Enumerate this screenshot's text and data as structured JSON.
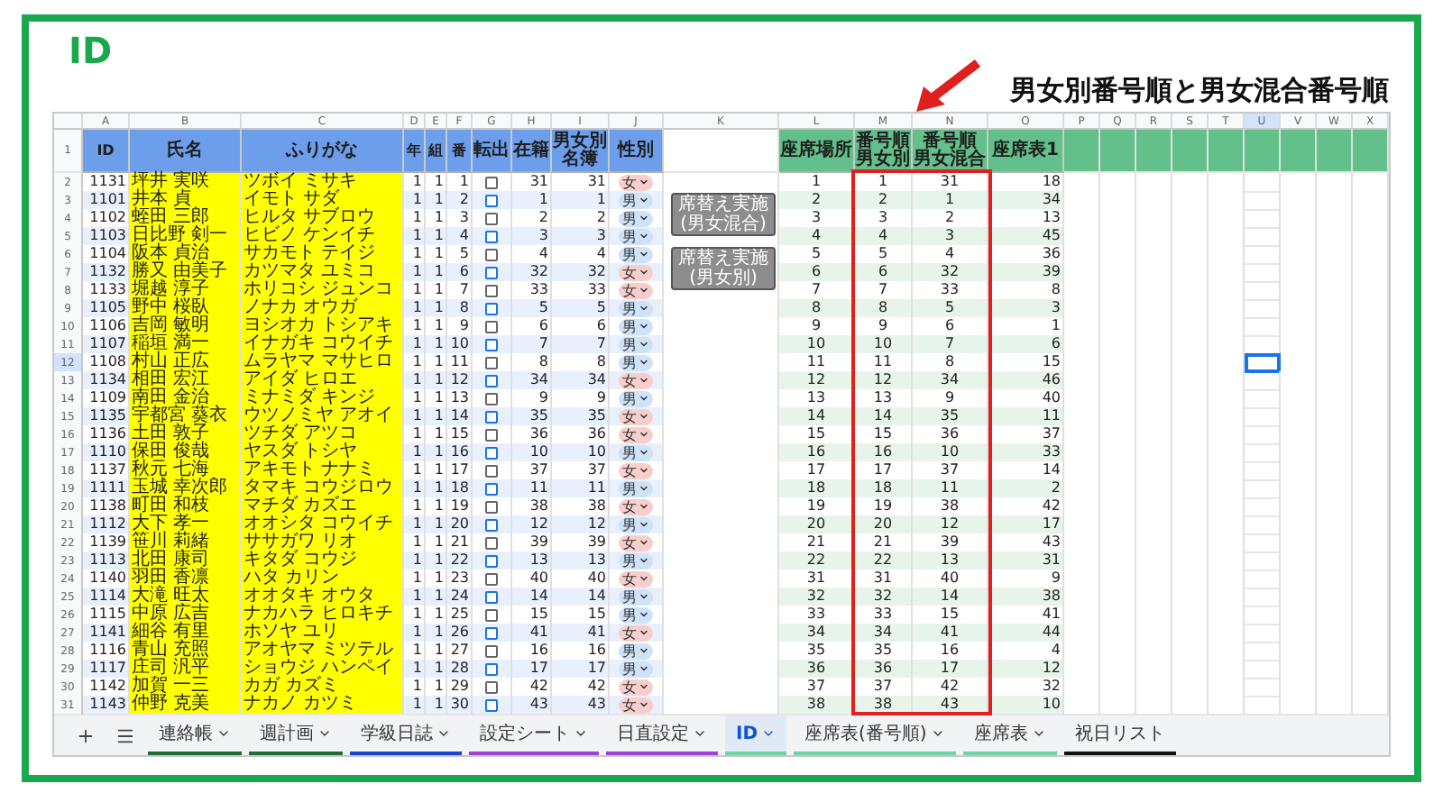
{
  "slide": {
    "title": "ID"
  },
  "annotation": {
    "text": "男女別番号順と男女混合番号順"
  },
  "sheet": {
    "column_letters": [
      {
        "label": "A",
        "selected": false
      },
      {
        "label": "B",
        "selected": false
      },
      {
        "label": "C",
        "selected": false
      },
      {
        "label": "D",
        "selected": false
      },
      {
        "label": "E",
        "selected": false
      },
      {
        "label": "F",
        "selected": false
      },
      {
        "label": "G",
        "selected": false
      },
      {
        "label": "H",
        "selected": false
      },
      {
        "label": "I",
        "selected": false
      },
      {
        "label": "J",
        "selected": false
      },
      {
        "label": "K",
        "selected": false
      },
      {
        "label": "L",
        "selected": false
      },
      {
        "label": "M",
        "selected": false
      },
      {
        "label": "N",
        "selected": false
      },
      {
        "label": "O",
        "selected": false
      },
      {
        "label": "P",
        "selected": false
      },
      {
        "label": "Q",
        "selected": false
      },
      {
        "label": "R",
        "selected": false
      },
      {
        "label": "S",
        "selected": false
      },
      {
        "label": "T",
        "selected": false
      },
      {
        "label": "U",
        "selected": true
      },
      {
        "label": "V",
        "selected": false
      },
      {
        "label": "W",
        "selected": false
      },
      {
        "label": "X",
        "selected": false
      }
    ],
    "header_row": "1",
    "left_headers": [
      "ID",
      "氏名",
      "ふりがな",
      "年",
      "組",
      "番",
      "転出",
      "在籍",
      "男女別名簿",
      "性別"
    ],
    "right_headers": [
      [
        "座席場所"
      ],
      [
        "番号順",
        "男女別"
      ],
      [
        "番号順",
        "男女混合"
      ],
      [
        "座席表1"
      ]
    ],
    "buttons": [
      "席替え実施\n(男女混合)",
      "席替え実施\n(男女別)"
    ],
    "rows": [
      {
        "row": "2",
        "id": "1131",
        "name": "坪井 実咲",
        "kana": "ツボイ ミサキ",
        "year": "1",
        "class": "1",
        "number": "1",
        "transferred": false,
        "enrolled": "31",
        "gender_roster": "31",
        "sex": {
          "value": "女",
          "color": "#f6cfcc"
        },
        "seat_place": "1",
        "order_by_gender": "1",
        "mixed_order": "31",
        "seating_1": "18",
        "selected": false
      },
      {
        "row": "3",
        "id": "1101",
        "name": "井本 貞",
        "kana": "イモト サダ",
        "year": "1",
        "class": "1",
        "number": "2",
        "transferred": false,
        "enrolled": "1",
        "gender_roster": "1",
        "sex": {
          "value": "男",
          "color": "#cfe2f8"
        },
        "seat_place": "2",
        "order_by_gender": "2",
        "mixed_order": "1",
        "seating_1": "34",
        "selected": false
      },
      {
        "row": "4",
        "id": "1102",
        "name": "蛭田 三郎",
        "kana": "ヒルタ サブロウ",
        "year": "1",
        "class": "1",
        "number": "3",
        "transferred": false,
        "enrolled": "2",
        "gender_roster": "2",
        "sex": {
          "value": "男",
          "color": "#cfe2f8"
        },
        "seat_place": "3",
        "order_by_gender": "3",
        "mixed_order": "2",
        "seating_1": "13",
        "selected": false
      },
      {
        "row": "5",
        "id": "1103",
        "name": "日比野 剣一",
        "kana": "ヒビノ ケンイチ",
        "year": "1",
        "class": "1",
        "number": "4",
        "transferred": false,
        "enrolled": "3",
        "gender_roster": "3",
        "sex": {
          "value": "男",
          "color": "#cfe2f8"
        },
        "seat_place": "4",
        "order_by_gender": "4",
        "mixed_order": "3",
        "seating_1": "45",
        "selected": false
      },
      {
        "row": "6",
        "id": "1104",
        "name": "阪本 貞治",
        "kana": "サカモト テイジ",
        "year": "1",
        "class": "1",
        "number": "5",
        "transferred": false,
        "enrolled": "4",
        "gender_roster": "4",
        "sex": {
          "value": "男",
          "color": "#cfe2f8"
        },
        "seat_place": "5",
        "order_by_gender": "5",
        "mixed_order": "4",
        "seating_1": "36",
        "selected": false
      },
      {
        "row": "7",
        "id": "1132",
        "name": "勝又 由美子",
        "kana": "カツマタ ユミコ",
        "year": "1",
        "class": "1",
        "number": "6",
        "transferred": false,
        "enrolled": "32",
        "gender_roster": "32",
        "sex": {
          "value": "女",
          "color": "#f6cfcc"
        },
        "seat_place": "6",
        "order_by_gender": "6",
        "mixed_order": "32",
        "seating_1": "39",
        "selected": false
      },
      {
        "row": "8",
        "id": "1133",
        "name": "堀越 淳子",
        "kana": "ホリコシ ジュンコ",
        "year": "1",
        "class": "1",
        "number": "7",
        "transferred": false,
        "enrolled": "33",
        "gender_roster": "33",
        "sex": {
          "value": "女",
          "color": "#f6cfcc"
        },
        "seat_place": "7",
        "order_by_gender": "7",
        "mixed_order": "33",
        "seating_1": "8",
        "selected": false
      },
      {
        "row": "9",
        "id": "1105",
        "name": "野中 桜臥",
        "kana": "ノナカ オウガ",
        "year": "1",
        "class": "1",
        "number": "8",
        "transferred": false,
        "enrolled": "5",
        "gender_roster": "5",
        "sex": {
          "value": "男",
          "color": "#cfe2f8"
        },
        "seat_place": "8",
        "order_by_gender": "8",
        "mixed_order": "5",
        "seating_1": "3",
        "selected": false
      },
      {
        "row": "10",
        "id": "1106",
        "name": "吉岡 敏明",
        "kana": "ヨシオカ トシアキ",
        "year": "1",
        "class": "1",
        "number": "9",
        "transferred": false,
        "enrolled": "6",
        "gender_roster": "6",
        "sex": {
          "value": "男",
          "color": "#cfe2f8"
        },
        "seat_place": "9",
        "order_by_gender": "9",
        "mixed_order": "6",
        "seating_1": "1",
        "selected": false
      },
      {
        "row": "11",
        "id": "1107",
        "name": "稲垣 満一",
        "kana": "イナガキ コウイチ",
        "year": "1",
        "class": "1",
        "number": "10",
        "transferred": false,
        "enrolled": "7",
        "gender_roster": "7",
        "sex": {
          "value": "男",
          "color": "#cfe2f8"
        },
        "seat_place": "10",
        "order_by_gender": "10",
        "mixed_order": "7",
        "seating_1": "6",
        "selected": false
      },
      {
        "row": "12",
        "id": "1108",
        "name": "村山 正広",
        "kana": "ムラヤマ マサヒロ",
        "year": "1",
        "class": "1",
        "number": "11",
        "transferred": false,
        "enrolled": "8",
        "gender_roster": "8",
        "sex": {
          "value": "男",
          "color": "#cfe2f8"
        },
        "seat_place": "11",
        "order_by_gender": "11",
        "mixed_order": "8",
        "seating_1": "15",
        "selected": true
      },
      {
        "row": "13",
        "id": "1134",
        "name": "相田 宏江",
        "kana": "アイダ ヒロエ",
        "year": "1",
        "class": "1",
        "number": "12",
        "transferred": false,
        "enrolled": "34",
        "gender_roster": "34",
        "sex": {
          "value": "女",
          "color": "#f6cfcc"
        },
        "seat_place": "12",
        "order_by_gender": "12",
        "mixed_order": "34",
        "seating_1": "46",
        "selected": false
      },
      {
        "row": "14",
        "id": "1109",
        "name": "南田 金治",
        "kana": "ミナミダ キンジ",
        "year": "1",
        "class": "1",
        "number": "13",
        "transferred": false,
        "enrolled": "9",
        "gender_roster": "9",
        "sex": {
          "value": "男",
          "color": "#cfe2f8"
        },
        "seat_place": "13",
        "order_by_gender": "13",
        "mixed_order": "9",
        "seating_1": "40",
        "selected": false
      },
      {
        "row": "15",
        "id": "1135",
        "name": "宇都宮 葵衣",
        "kana": "ウツノミヤ アオイ",
        "year": "1",
        "class": "1",
        "number": "14",
        "transferred": false,
        "enrolled": "35",
        "gender_roster": "35",
        "sex": {
          "value": "女",
          "color": "#f6cfcc"
        },
        "seat_place": "14",
        "order_by_gender": "14",
        "mixed_order": "35",
        "seating_1": "11",
        "selected": false
      },
      {
        "row": "16",
        "id": "1136",
        "name": "土田 敦子",
        "kana": "ツチダ アツコ",
        "year": "1",
        "class": "1",
        "number": "15",
        "transferred": false,
        "enrolled": "36",
        "gender_roster": "36",
        "sex": {
          "value": "女",
          "color": "#f6cfcc"
        },
        "seat_place": "15",
        "order_by_gender": "15",
        "mixed_order": "36",
        "seating_1": "37",
        "selected": false
      },
      {
        "row": "17",
        "id": "1110",
        "name": "保田 俊哉",
        "kana": "ヤスダ トシヤ",
        "year": "1",
        "class": "1",
        "number": "16",
        "transferred": false,
        "enrolled": "10",
        "gender_roster": "10",
        "sex": {
          "value": "男",
          "color": "#cfe2f8"
        },
        "seat_place": "16",
        "order_by_gender": "16",
        "mixed_order": "10",
        "seating_1": "33",
        "selected": false
      },
      {
        "row": "18",
        "id": "1137",
        "name": "秋元 七海",
        "kana": "アキモト ナナミ",
        "year": "1",
        "class": "1",
        "number": "17",
        "transferred": false,
        "enrolled": "37",
        "gender_roster": "37",
        "sex": {
          "value": "女",
          "color": "#f6cfcc"
        },
        "seat_place": "17",
        "order_by_gender": "17",
        "mixed_order": "37",
        "seating_1": "14",
        "selected": false
      },
      {
        "row": "19",
        "id": "1111",
        "name": "玉城 幸次郎",
        "kana": "タマキ コウジロウ",
        "year": "1",
        "class": "1",
        "number": "18",
        "transferred": false,
        "enrolled": "11",
        "gender_roster": "11",
        "sex": {
          "value": "男",
          "color": "#cfe2f8"
        },
        "seat_place": "18",
        "order_by_gender": "18",
        "mixed_order": "11",
        "seating_1": "2",
        "selected": false
      },
      {
        "row": "20",
        "id": "1138",
        "name": "町田 和枝",
        "kana": "マチダ カズエ",
        "year": "1",
        "class": "1",
        "number": "19",
        "transferred": false,
        "enrolled": "38",
        "gender_roster": "38",
        "sex": {
          "value": "女",
          "color": "#f6cfcc"
        },
        "seat_place": "19",
        "order_by_gender": "19",
        "mixed_order": "38",
        "seating_1": "42",
        "selected": false
      },
      {
        "row": "21",
        "id": "1112",
        "name": "大下 孝一",
        "kana": "オオシタ コウイチ",
        "year": "1",
        "class": "1",
        "number": "20",
        "transferred": false,
        "enrolled": "12",
        "gender_roster": "12",
        "sex": {
          "value": "男",
          "color": "#cfe2f8"
        },
        "seat_place": "20",
        "order_by_gender": "20",
        "mixed_order": "12",
        "seating_1": "17",
        "selected": false
      },
      {
        "row": "22",
        "id": "1139",
        "name": "笹川 莉緒",
        "kana": "ササガワ リオ",
        "year": "1",
        "class": "1",
        "number": "21",
        "transferred": false,
        "enrolled": "39",
        "gender_roster": "39",
        "sex": {
          "value": "女",
          "color": "#f6cfcc"
        },
        "seat_place": "21",
        "order_by_gender": "21",
        "mixed_order": "39",
        "seating_1": "43",
        "selected": false
      },
      {
        "row": "23",
        "id": "1113",
        "name": "北田 康司",
        "kana": "キタダ コウジ",
        "year": "1",
        "class": "1",
        "number": "22",
        "transferred": false,
        "enrolled": "13",
        "gender_roster": "13",
        "sex": {
          "value": "男",
          "color": "#cfe2f8"
        },
        "seat_place": "22",
        "order_by_gender": "22",
        "mixed_order": "13",
        "seating_1": "31",
        "selected": false
      },
      {
        "row": "24",
        "id": "1140",
        "name": "羽田 香凛",
        "kana": "ハタ カリン",
        "year": "1",
        "class": "1",
        "number": "23",
        "transferred": false,
        "enrolled": "40",
        "gender_roster": "40",
        "sex": {
          "value": "女",
          "color": "#f6cfcc"
        },
        "seat_place": "31",
        "order_by_gender": "31",
        "mixed_order": "40",
        "seating_1": "9",
        "selected": false
      },
      {
        "row": "25",
        "id": "1114",
        "name": "大滝 旺太",
        "kana": "オオタキ オウタ",
        "year": "1",
        "class": "1",
        "number": "24",
        "transferred": false,
        "enrolled": "14",
        "gender_roster": "14",
        "sex": {
          "value": "男",
          "color": "#cfe2f8"
        },
        "seat_place": "32",
        "order_by_gender": "32",
        "mixed_order": "14",
        "seating_1": "38",
        "selected": false
      },
      {
        "row": "26",
        "id": "1115",
        "name": "中原 広吉",
        "kana": "ナカハラ ヒロキチ",
        "year": "1",
        "class": "1",
        "number": "25",
        "transferred": false,
        "enrolled": "15",
        "gender_roster": "15",
        "sex": {
          "value": "男",
          "color": "#cfe2f8"
        },
        "seat_place": "33",
        "order_by_gender": "33",
        "mixed_order": "15",
        "seating_1": "41",
        "selected": false
      },
      {
        "row": "27",
        "id": "1141",
        "name": "細谷 有里",
        "kana": "ホソヤ ユリ",
        "year": "1",
        "class": "1",
        "number": "26",
        "transferred": false,
        "enrolled": "41",
        "gender_roster": "41",
        "sex": {
          "value": "女",
          "color": "#f6cfcc"
        },
        "seat_place": "34",
        "order_by_gender": "34",
        "mixed_order": "41",
        "seating_1": "44",
        "selected": false
      },
      {
        "row": "28",
        "id": "1116",
        "name": "青山 充照",
        "kana": "アオヤマ ミツテル",
        "year": "1",
        "class": "1",
        "number": "27",
        "transferred": false,
        "enrolled": "16",
        "gender_roster": "16",
        "sex": {
          "value": "男",
          "color": "#cfe2f8"
        },
        "seat_place": "35",
        "order_by_gender": "35",
        "mixed_order": "16",
        "seating_1": "4",
        "selected": false
      },
      {
        "row": "29",
        "id": "1117",
        "name": "庄司 汎平",
        "kana": "ショウジ ハンペイ",
        "year": "1",
        "class": "1",
        "number": "28",
        "transferred": false,
        "enrolled": "17",
        "gender_roster": "17",
        "sex": {
          "value": "男",
          "color": "#cfe2f8"
        },
        "seat_place": "36",
        "order_by_gender": "36",
        "mixed_order": "17",
        "seating_1": "12",
        "selected": false
      },
      {
        "row": "30",
        "id": "1142",
        "name": "加賀 一三",
        "kana": "カガ カズミ",
        "year": "1",
        "class": "1",
        "number": "29",
        "transferred": false,
        "enrolled": "42",
        "gender_roster": "42",
        "sex": {
          "value": "女",
          "color": "#f6cfcc"
        },
        "seat_place": "37",
        "order_by_gender": "37",
        "mixed_order": "42",
        "seating_1": "32",
        "selected": false
      },
      {
        "row": "31",
        "id": "1143",
        "name": "仲野 克美",
        "kana": "ナカノ カツミ",
        "year": "1",
        "class": "1",
        "number": "30",
        "transferred": false,
        "enrolled": "43",
        "gender_roster": "43",
        "sex": {
          "value": "女",
          "color": "#f6cfcc"
        },
        "seat_place": "38",
        "order_by_gender": "38",
        "mixed_order": "43",
        "seating_1": "10",
        "selected": false
      }
    ],
    "tabs": [
      {
        "label": "連絡帳",
        "selected": false,
        "caret": true,
        "color": "#1e6b35"
      },
      {
        "label": "週計画",
        "selected": false,
        "caret": true,
        "color": "#1e6b35"
      },
      {
        "label": "学級日誌",
        "selected": false,
        "caret": true,
        "color": "#1c3fd6"
      },
      {
        "label": "設定シート",
        "selected": false,
        "caret": true,
        "color": "#a13fd6"
      },
      {
        "label": "日直設定",
        "selected": false,
        "caret": true,
        "color": "#a13fd6"
      },
      {
        "label": "ID",
        "selected": true,
        "caret": true,
        "color": "#6fd3a5"
      },
      {
        "label": "座席表(番号順)",
        "selected": false,
        "caret": true,
        "color": "#6fd3a5"
      },
      {
        "label": "座席表",
        "selected": false,
        "caret": true,
        "color": "#6fd3a5"
      },
      {
        "label": "祝日リスト",
        "selected": false,
        "caret": false,
        "color": "#111111"
      }
    ]
  }
}
